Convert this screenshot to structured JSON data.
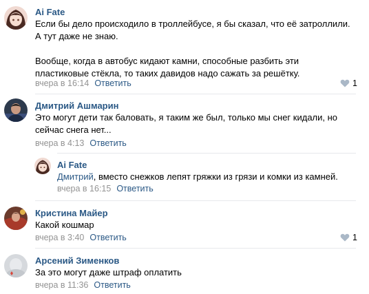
{
  "comments": [
    {
      "author": "Ai Fate",
      "lines": [
        "Если бы дело происходило в троллейбусе, я бы сказал, что её затроллили.",
        "А тут даже не знаю.",
        "",
        "Вообще, когда в автобус кидают камни, способные разбить эти",
        "пластиковые стёкла, то таких давидов надо сажать за решётку."
      ],
      "time": "вчера в 16:14",
      "reply_label": "Ответить",
      "likes": "1"
    },
    {
      "author": "Дмитрий Ашмарин",
      "lines": [
        "Это могут дети так баловать, я таким же был, только мы снег кидали, но",
        "сейчас снега нет..."
      ],
      "time": "вчера в 4:13",
      "reply_label": "Ответить"
    },
    {
      "author": "Ai Fate",
      "mention": "Дмитрий",
      "text_after_mention": ", вместо снежков лепят гряжки из грязи и комки из камней.",
      "time": "вчера в 16:15",
      "reply_label": "Ответить"
    },
    {
      "author": "Кристина Майер",
      "lines": [
        "Какой кошмар"
      ],
      "time": "вчера в 3:40",
      "reply_label": "Ответить",
      "likes": "1"
    },
    {
      "author": "Арсений Зименков",
      "lines": [
        "За это могут даже штраф оплатить"
      ],
      "time": "вчера в 11:36",
      "reply_label": "Ответить"
    }
  ],
  "colors": {
    "link": "#2a5885",
    "meta": "#939393",
    "separator": "#e7e8ec"
  }
}
